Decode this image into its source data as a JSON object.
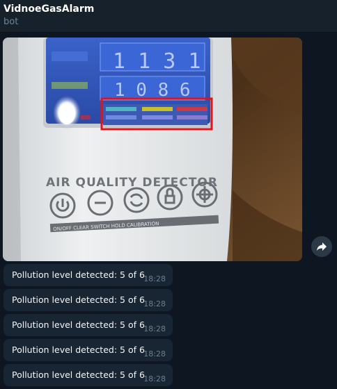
{
  "chat": {
    "title": "VidnoeGasAlarm",
    "subtitle": "bot"
  },
  "photo": {
    "device_label": "AIR QUALITY DETECTOR",
    "readings": [
      "1 1 3 1",
      "1 0 8 6"
    ],
    "button_captions": "ON/OFF  CLEAR  SWITCH  HOLD  CALIBRATION",
    "highlight_color": "#e0141c"
  },
  "forward_icon": "forward-arrow-icon",
  "messages": [
    {
      "text": "Pollution level detected: 5 of 6",
      "time": "18:28"
    },
    {
      "text": "Pollution level detected: 5 of 6",
      "time": "18:28"
    },
    {
      "text": "Pollution level detected: 5 of 6",
      "time": "18:28"
    },
    {
      "text": "Pollution level detected: 5 of 6",
      "time": "18:28"
    },
    {
      "text": "Pollution level detected: 5 of 6",
      "time": "18:28"
    }
  ]
}
